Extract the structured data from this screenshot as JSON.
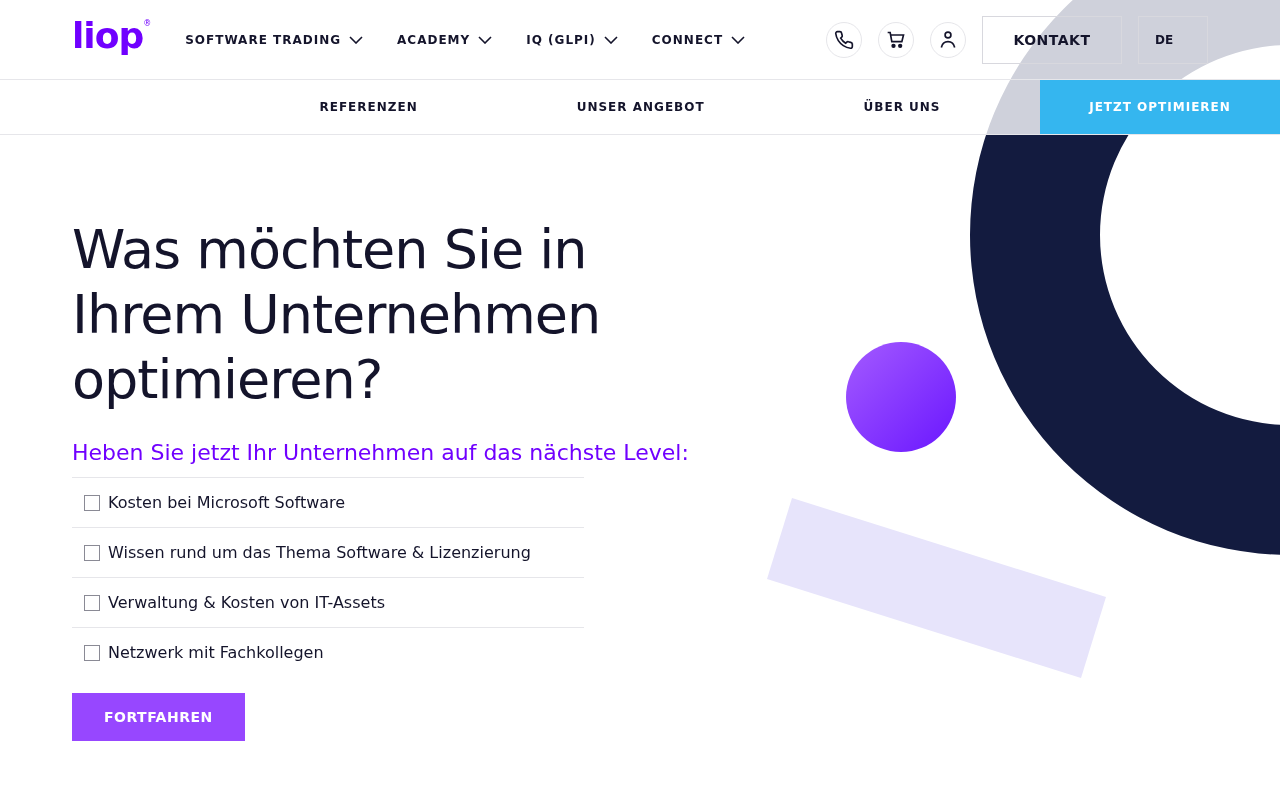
{
  "header": {
    "logo": "liop",
    "logo_mark": "®",
    "nav": [
      {
        "label": "SOFTWARE TRADING"
      },
      {
        "label": "ACADEMY"
      },
      {
        "label": "IQ (GLPI)"
      },
      {
        "label": "CONNECT"
      }
    ],
    "contact_button": "KONTAKT",
    "language_button": "DE"
  },
  "subnav": {
    "links": [
      "REFERENZEN",
      "UNSER ANGEBOT",
      "ÜBER UNS"
    ],
    "cta": "JETZT OPTIMIEREN"
  },
  "hero": {
    "title": "Was möchten Sie in Ihrem Unternehmen optimieren?",
    "subtitle": "Heben Sie jetzt Ihr Unternehmen auf das nächste Level:",
    "options": [
      {
        "label": "Kosten bei Microsoft Software",
        "checked": false
      },
      {
        "label": "Wissen rund um das Thema Software & Lizenzierung",
        "checked": false
      },
      {
        "label": "Verwaltung & Kosten von IT-Assets",
        "checked": false
      },
      {
        "label": "Netzwerk mit Fachkollegen",
        "checked": false
      }
    ],
    "button": "FORTFAHREN"
  }
}
